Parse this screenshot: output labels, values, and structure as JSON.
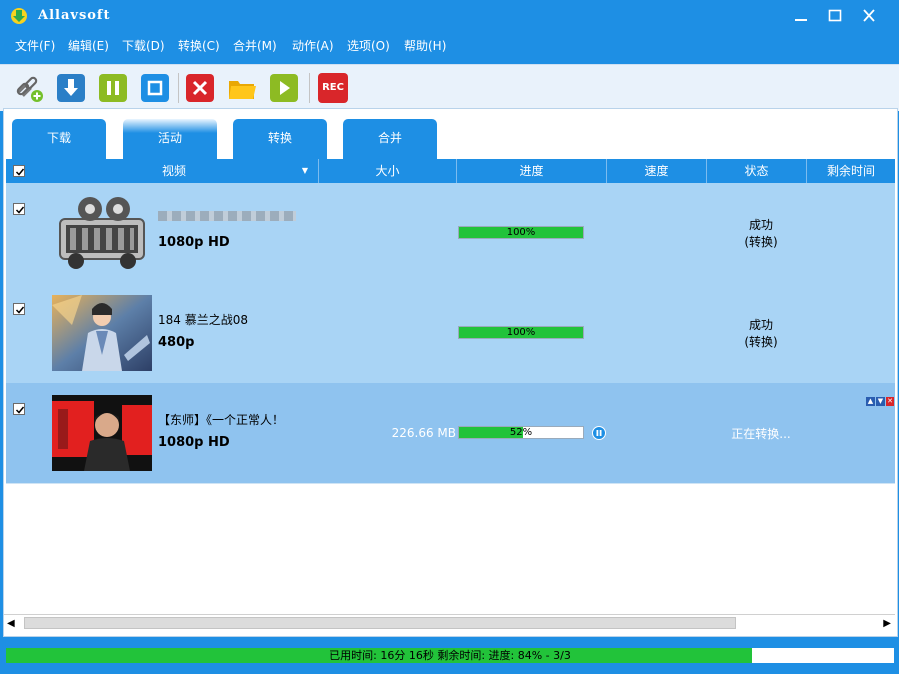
{
  "window": {
    "title": "Allavsoft"
  },
  "menu": [
    "文件(F)",
    "编辑(E)",
    "下载(D)",
    "转换(C)",
    "合并(M)",
    "动作(A)",
    "选项(O)",
    "帮助(H)"
  ],
  "toolbar": {
    "rec_label": "REC"
  },
  "tabs": [
    {
      "label": "下载",
      "active": false
    },
    {
      "label": "活动",
      "active": true
    },
    {
      "label": "转换",
      "active": false
    },
    {
      "label": "合并",
      "active": false
    }
  ],
  "columns": [
    "视频",
    "大小",
    "进度",
    "速度",
    "状态",
    "剩余时间"
  ],
  "rows": [
    {
      "title": "",
      "resolution": "1080p HD",
      "size": "",
      "progress_text": "100%",
      "progress": 1.0,
      "status": "成功",
      "status_sub": "(转换)",
      "checked": true
    },
    {
      "title": "184 慕兰之战08",
      "resolution": "480p",
      "size": "",
      "progress_text": "100%",
      "progress": 1.0,
      "status": "成功",
      "status_sub": "(转换)",
      "checked": true
    },
    {
      "title": "【东师】《一个正常人！",
      "resolution": "1080p HD",
      "size": "226.66 MB",
      "progress_text": "52%",
      "progress": 0.52,
      "status": "正在转换...",
      "status_sub": "",
      "checked": true
    }
  ],
  "statusbar": {
    "text": "已用时间: 16分 16秒 剩余时间:  进度: 84% - 3/3",
    "progress": 0.84
  },
  "colors": {
    "accent": "#1e8fe4",
    "progress": "#22c33a"
  }
}
